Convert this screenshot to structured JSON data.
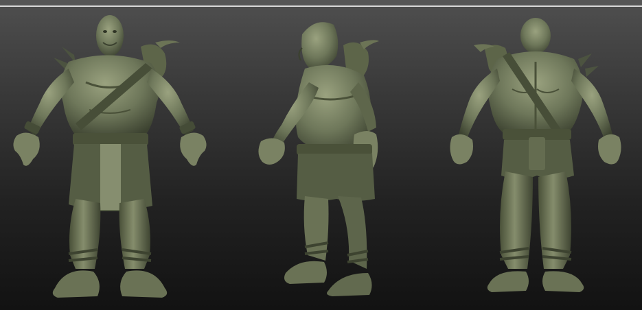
{
  "scene": {
    "description_free": true,
    "background_top_color": "#4f4f4f",
    "background_bottom_color": "#121212",
    "top_rule_color": "#d9d9d9"
  },
  "model": {
    "skin_base_color": "#6e775a",
    "skin_shadow_color": "#3c4230",
    "skin_highlight_color": "#9aa27f",
    "leather_color": "#555d44",
    "views": [
      {
        "id": "front",
        "icon": "ogre-front-view"
      },
      {
        "id": "side",
        "icon": "ogre-side-view"
      },
      {
        "id": "back",
        "icon": "ogre-back-view"
      }
    ]
  }
}
